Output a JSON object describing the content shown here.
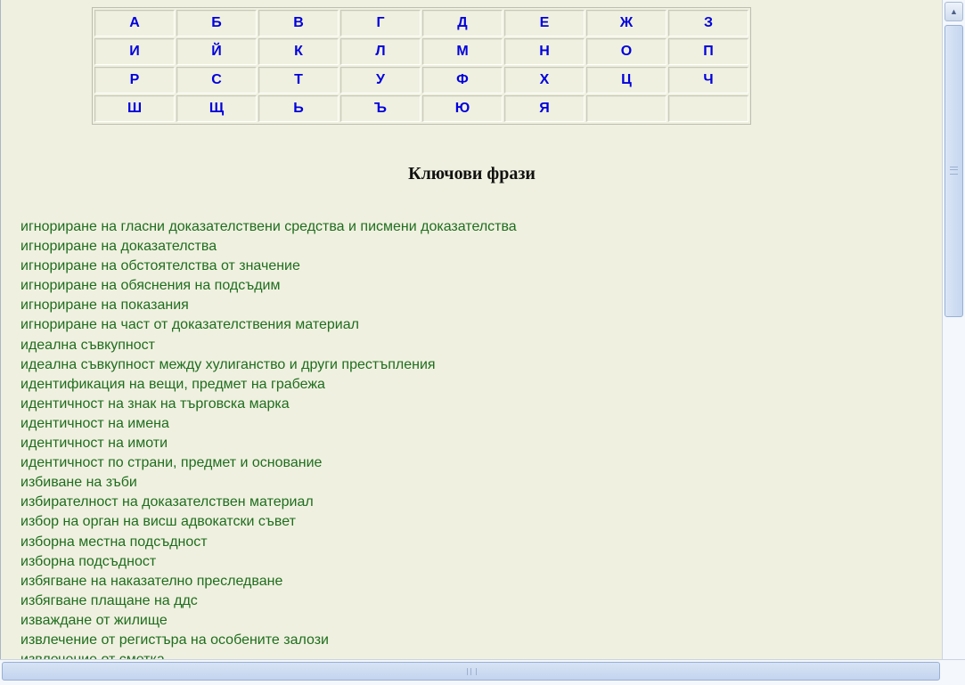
{
  "alphabet": {
    "rows": [
      [
        "А",
        "Б",
        "В",
        "Г",
        "Д",
        "Е",
        "Ж",
        "З"
      ],
      [
        "И",
        "Й",
        "К",
        "Л",
        "М",
        "Н",
        "О",
        "П"
      ],
      [
        "Р",
        "С",
        "Т",
        "У",
        "Ф",
        "Х",
        "Ц",
        "Ч"
      ],
      [
        "Ш",
        "Щ",
        "Ь",
        "Ъ",
        "Ю",
        "Я",
        "",
        ""
      ]
    ]
  },
  "heading": "Ключови фрази",
  "phrases": [
    "игнориране на гласни доказателствени средства и писмени доказателства",
    "игнориране на доказателства",
    "игнориране на обстоятелства от значение",
    "игнориране на обяснения на подсъдим",
    "игнориране на показания",
    "игнориране на част от доказателствения материал",
    "идеална съвкупност",
    "идеална съвкупност между хулиганство и други престъпления",
    "идентификация на вещи, предмет на грабежа",
    "идентичност на знак на търговска марка",
    "идентичност на имена",
    "идентичност на имоти",
    "идентичност по страни, предмет и основание",
    "избиване на зъби",
    "избирателност на доказателствен материал",
    "избор на орган на висш адвокатски съвет",
    "изборна местна подсъдност",
    "изборна подсъдност",
    "избягване на наказателно преследване",
    "избягване плащане на ддс",
    "изваждане от жилище",
    "извлечение от регистъра на особените залози",
    "извлечение от сметка"
  ],
  "scrollbar": {
    "up_arrow_icon": "scroll-up-arrow-icon"
  },
  "colors": {
    "page_background": "#f0f0e0",
    "letter_link": "#0000dd",
    "phrase_link": "#1e6e1e"
  }
}
